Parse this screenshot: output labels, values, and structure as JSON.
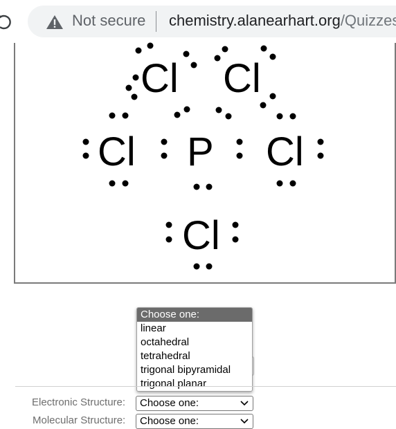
{
  "browser": {
    "security_label": "Not secure",
    "url_host": "chemistry.alanearhart.org",
    "url_path": "/Quizzes/s"
  },
  "molecule": {
    "central_atom": "P",
    "ligand_atom": "Cl"
  },
  "dropdown_popup": {
    "options": [
      "Choose one:",
      "linear",
      "octahedral",
      "tetrahedral",
      "trigonal bipyramidal",
      "trigonal planar"
    ],
    "highlighted": "Choose one:"
  },
  "form": {
    "electronic_label": "Electronic Structure:",
    "electronic_value": "Choose one:",
    "molecular_label": "Molecular Structure:",
    "molecular_value": "Choose one:"
  }
}
